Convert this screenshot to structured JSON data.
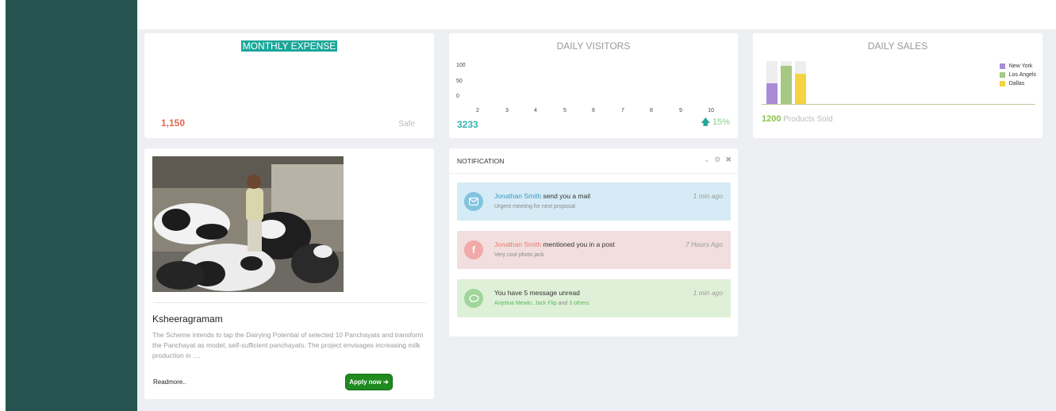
{
  "expense": {
    "title": "MONTHLY EXPENSE",
    "value": "1,150",
    "status": "Safe"
  },
  "visitors": {
    "title": "DAILY VISITORS",
    "total": "3233",
    "change": "15%",
    "chart_data": {
      "type": "line",
      "title": "DAILY VISITORS",
      "x": [
        2,
        3,
        4,
        5,
        6,
        7,
        8,
        9,
        10
      ],
      "y_ticks": [
        "100",
        "50",
        "0"
      ],
      "x_ticks": [
        "2",
        "3",
        "4",
        "5",
        "6",
        "7",
        "8",
        "9",
        "10"
      ],
      "series": []
    }
  },
  "sales": {
    "title": "DAILY SALES",
    "sold_value": "1200",
    "sold_label": "Products Sold",
    "chart_data": {
      "type": "bar",
      "title": "DAILY SALES",
      "series": [
        {
          "name": "New York",
          "value": 0.48,
          "color": "#a98bd6"
        },
        {
          "name": "Los Angels",
          "value": 0.88,
          "color": "#a5c882"
        },
        {
          "name": "Dallas",
          "value": 0.7,
          "color": "#f5d342"
        }
      ],
      "legend": "right"
    }
  },
  "news": {
    "title": "Ksheeragramam",
    "text": "The Scheme intends to tap the Dairying Potential of selected 10 Panchayats and transform the Panchayat as model, self-sufficient panchayats. The project envisages increasing milk production in ....",
    "readmore": "Readmore..",
    "apply": "Apply now"
  },
  "notifications": {
    "title": "NOTIFICATION",
    "items": [
      {
        "who": "Jonathan Smith",
        "action": "send you a mail",
        "detail": "Urgent meeting for next proposal",
        "time": "1 min ago",
        "icon": "mail-icon"
      },
      {
        "who": "Jonathan Smith",
        "action": "mentioned you in a post",
        "detail": "Very cool photo jack",
        "time": "7 Hours Ago",
        "icon": "facebook-icon"
      },
      {
        "who": "",
        "action": "You have 5 message unread",
        "detail_a": "Anjelina Mewlo, Jack Flip",
        "detail_and": "and",
        "detail_b": "3 others",
        "time": "1 min ago",
        "icon": "chat-icon"
      }
    ]
  }
}
